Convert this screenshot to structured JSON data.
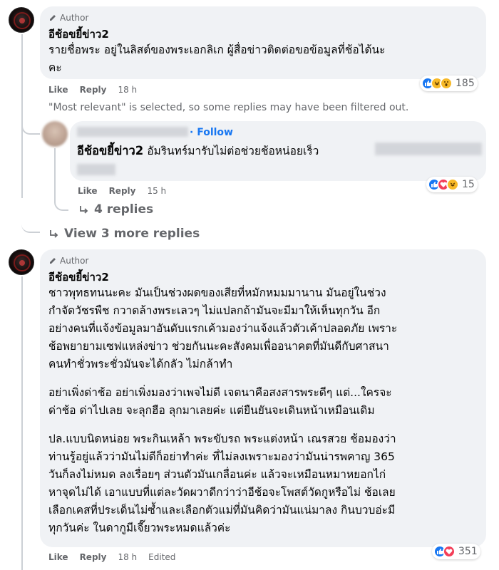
{
  "comment1": {
    "badge": "Author",
    "name": "อีช้อขยี้ข่าว2",
    "text_lines": [
      "รายชื่อพระ อยู่ในลิสต์ของพระเอกลิเก ผู้สื่อข่าวติดต่อขอข้อมูลที่ช้อได้นะ",
      "คะ"
    ],
    "like": "Like",
    "reply": "Reply",
    "time": "18 h",
    "reaction_count": "185",
    "reaction_icons": [
      "like-icon",
      "haha-icon",
      "wow-icon"
    ]
  },
  "filter_note": "\"Most relevant\" is selected, so some replies may have been filtered out.",
  "reply1": {
    "follow": "Follow",
    "mention": "อีช้อขยี้ข่าว2",
    "text": "อัมรินทร์มารับไม่ต่อช่วยช้อหน่อยเร็ว",
    "like": "Like",
    "reply": "Reply",
    "time": "15 h",
    "reaction_count": "15",
    "reaction_icons": [
      "like-icon",
      "love-icon",
      "haha-icon"
    ]
  },
  "replies_link": "4 replies",
  "more_replies_link": "View 3 more replies",
  "comment2": {
    "badge": "Author",
    "name": "อีช้อขยี้ข่าว2",
    "paragraph1": [
      "ชาวพุทธทนนะคะ มันเป็นช่วงผดของเสียที่หมักหมมมานาน มันอยู่ในช่วง",
      "กำจัดวัชรพืช กวาดล้างพระเลวๆ ไม่แปลกถ้ามันจะมีมาให้เห็นทุกวัน อีก",
      "อย่างคนที่แจ้งข้อมูลมาอันดับแรกเค้ามองว่าแจ้งแล้วตัวเค้าปลอดภัย เพราะ",
      "ช้อพยายามเซฟแหล่งข่าว ช่วยกันนะคะสังคมเพื่ออนาคตที่มันดีกับศาสนา",
      "คนทำชั่วพระชั่วมันจะได้กลัว ไม่กล้าทำ"
    ],
    "paragraph2": [
      "อย่าเพิ่งด่าช้อ อย่าเพิ่งมองว่าเพจไม่ดี เจตนาคือสงสารพระดีๆ แต่...ใครจะ",
      "ด่าช้อ ด่าไปเลย จะลุกฮือ ลุกมาเลยค่ะ แต่ยืนยันจะเดินหน้าเหมือนเดิม"
    ],
    "paragraph3": [
      "ปล.แบบนิดหน่อย พระกินเหล้า พระขับรถ พระแต่งหน้า เณรสวย ช้อมองว่า",
      "ท่านรู้อยู่แล้วว่ามันไม่ดีก็อย่าทำค่ะ ที่ไม่ลงเพราะมองว่ามันน่ารพคาญ 365",
      "วันก็ลงไม่หมด ลงเรื่อยๆ ส่วนตัวมันเกลื่อนค่ะ แล้วจะเหมือนหมาหยอกไก่",
      "หาจุดไม่ได้ เอาแบบที่แต่ละวัดผวาดีกว่าว่าอีช้อจะโพสต์วัดกูหรือไม่ ช้อเลย",
      "เลือกเคสที่ประเด็นไม่ซ้ำและเลือกตัวแม่ที่มันคิดว่ามันแน่มาลง กินบวบอ่ะมี",
      "ทุกวันค่ะ ในดากูมีเจี๊ยวพระหมดแล้วค่ะ"
    ],
    "like": "Like",
    "reply": "Reply",
    "time": "18 h",
    "edited": "Edited",
    "reaction_count": "351",
    "reaction_icons": [
      "like-icon",
      "love-icon"
    ]
  },
  "colors": {
    "bubble": "#f0f2f5",
    "meta_text": "#65676b",
    "link_blue": "#1877f2",
    "thread_line": "#ccd0d5"
  }
}
